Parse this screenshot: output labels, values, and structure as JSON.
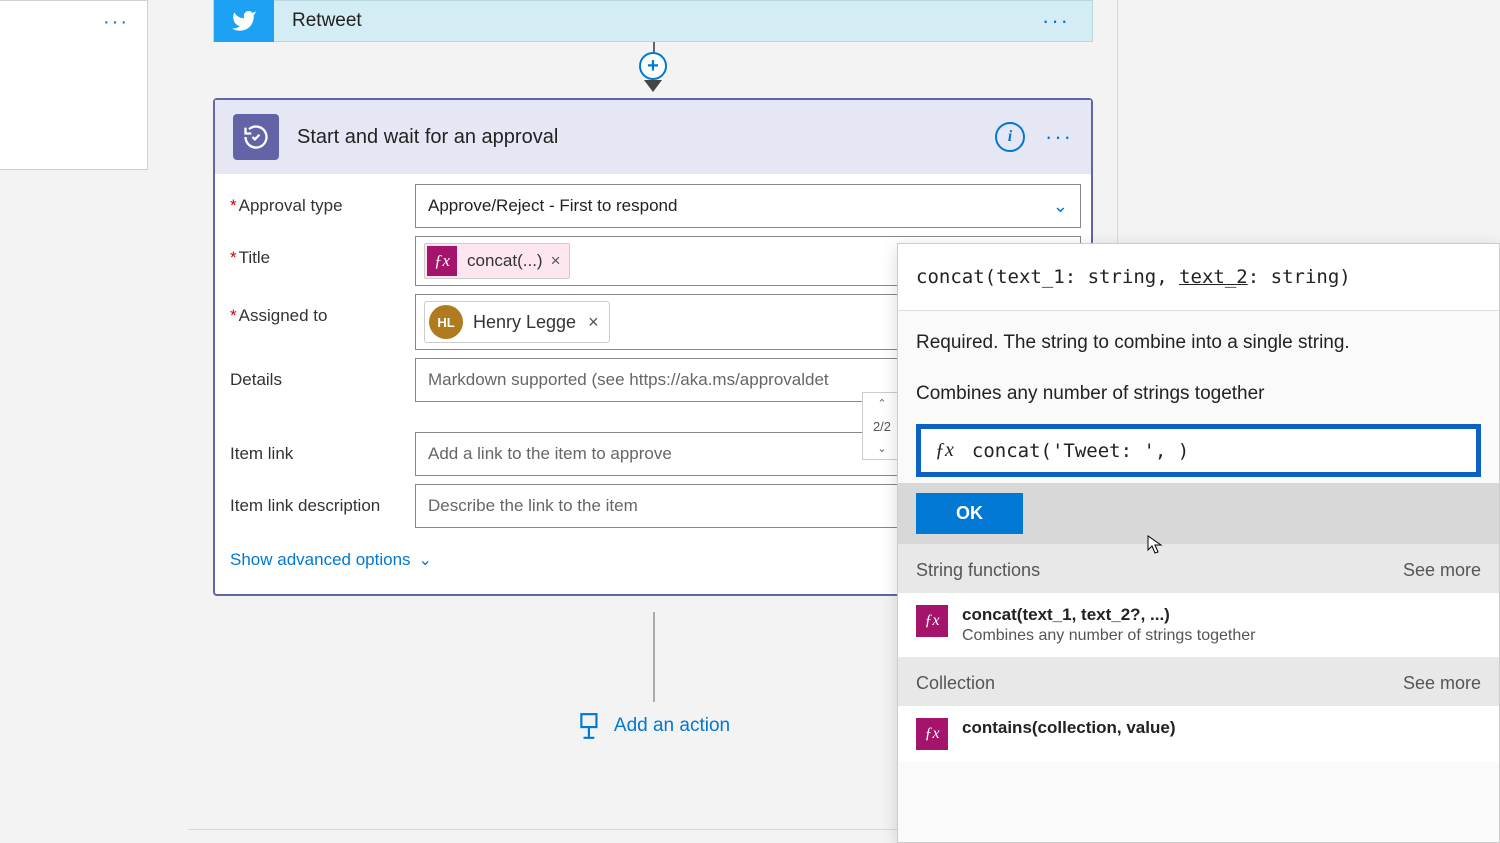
{
  "retweet": {
    "title": "Retweet"
  },
  "approval": {
    "header": "Start and wait for an approval",
    "fields": {
      "approval_type_label": "Approval type",
      "approval_type_value": "Approve/Reject - First to respond",
      "title_label": "Title",
      "title_token": "concat(...)",
      "assigned_to_label": "Assigned to",
      "assignee_initials": "HL",
      "assignee_name": "Henry Legge",
      "details_label": "Details",
      "details_placeholder": "Markdown supported (see https://aka.ms/approvaldet",
      "item_link_label": "Item link",
      "item_link_placeholder": "Add a link to the item to approve",
      "item_link_desc_label": "Item link description",
      "item_link_desc_placeholder": "Describe the link to the item"
    },
    "advanced_link": "Show advanced options"
  },
  "pager": "2/2",
  "add_action": "Add an action",
  "popup": {
    "signature_pre": "concat(text_1: string, ",
    "signature_u": "text_2",
    "signature_post": ": string)",
    "required_line": "Required. The string to combine into a single string.",
    "combine_line": "Combines any number of strings together",
    "fx_label": "ƒx",
    "expression_value": "concat('Tweet: ', )",
    "ok_label": "OK",
    "group_string": "String functions",
    "see_more": "See more",
    "fn1_sig": "concat(text_1, text_2?, ...)",
    "fn1_desc": "Combines any number of strings together",
    "group_collection": "Collection",
    "fn2_sig": "contains(collection, value)"
  }
}
